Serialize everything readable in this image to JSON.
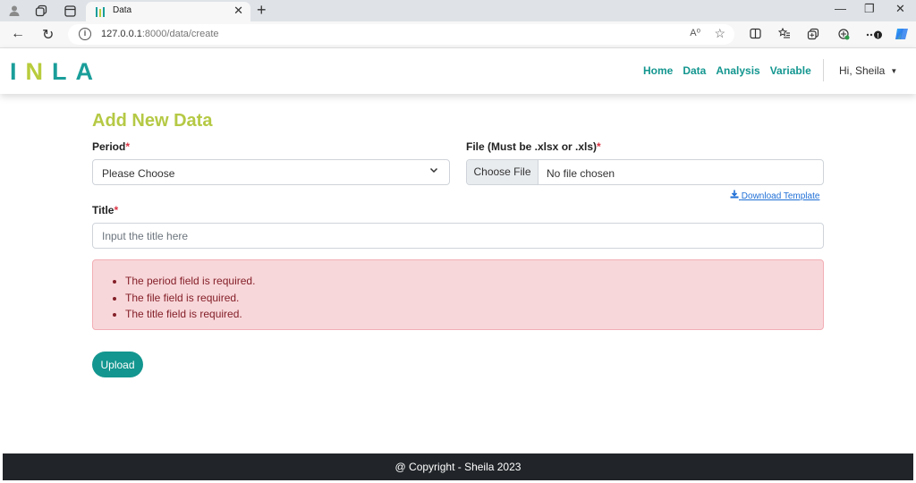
{
  "browser": {
    "tab_title": "Data",
    "url_host": "127.0.0.1",
    "url_path": ":8000/data/create",
    "read_aloud_label": "A⁰"
  },
  "app": {
    "logo_letters": [
      "I",
      "N",
      "L",
      "A"
    ],
    "brand_colors": {
      "teal": "#13968f",
      "lime": "#b5c944"
    },
    "nav": [
      "Home",
      "Data",
      "Analysis",
      "Variable"
    ],
    "user_menu": "Hi, Sheila"
  },
  "form": {
    "heading": "Add New Data",
    "period_label": "Period",
    "period_value": "Please Choose",
    "file_label": "File (Must be .xlsx or .xls)",
    "file_button": "Choose File",
    "file_status": "No file chosen",
    "download_template": "Download Template",
    "title_label": "Title",
    "title_placeholder": "Input the title here",
    "required_mark": "*",
    "errors": [
      "The period field is required.",
      "The file field is required.",
      "The title field is required."
    ],
    "submit": "Upload"
  },
  "footer": {
    "text": "@ Copyright - Sheila 2023"
  }
}
